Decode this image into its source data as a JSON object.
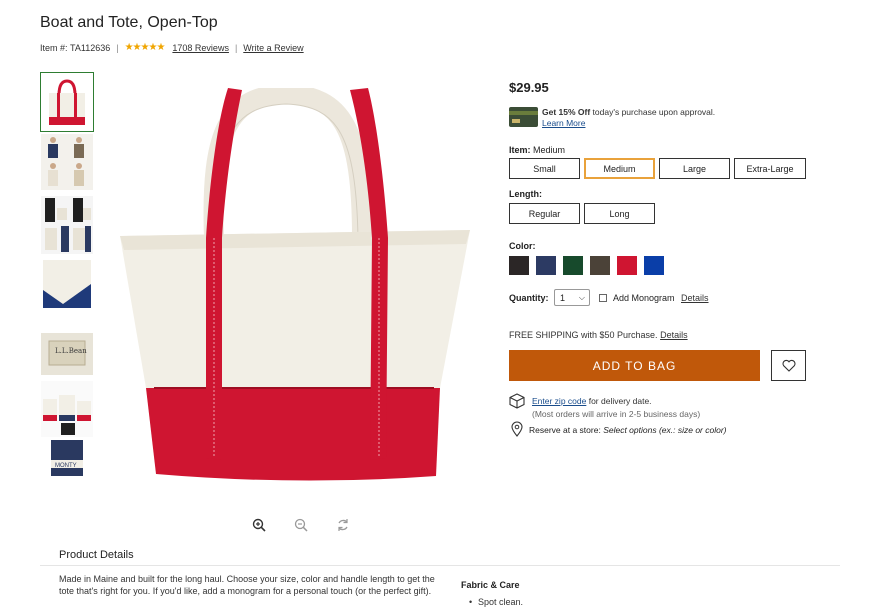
{
  "product": {
    "title": "Boat and Tote, Open-Top",
    "item_prefix": "Item #:",
    "item_number": "TA112636",
    "stars": "★★★★★",
    "reviews_link": "1708 Reviews",
    "write_review_link": "Write a Review",
    "price": "$29.95"
  },
  "credit_offer": {
    "bold": "Get 15% Off",
    "text": " today's purchase upon approval.",
    "link": "Learn More"
  },
  "item_option": {
    "label": "Item:",
    "selected_value": "Medium",
    "options": [
      "Small",
      "Medium",
      "Large",
      "Extra-Large"
    ]
  },
  "length_option": {
    "label": "Length:",
    "options": [
      "Regular",
      "Long"
    ]
  },
  "color_option": {
    "label": "Color:",
    "swatches": [
      {
        "name": "black",
        "hex": "#2b2626"
      },
      {
        "name": "navy",
        "hex": "#2c3a63"
      },
      {
        "name": "hunter-green",
        "hex": "#174a2c"
      },
      {
        "name": "brown",
        "hex": "#4b4238"
      },
      {
        "name": "red",
        "hex": "#cf1531"
      },
      {
        "name": "blue",
        "hex": "#0a3ea8"
      }
    ]
  },
  "quantity": {
    "label": "Quantity:",
    "value": "1"
  },
  "monogram": {
    "label": "Add Monogram",
    "details_link": "Details",
    "checked": false
  },
  "shipping": {
    "text": "FREE SHIPPING with $50 Purchase.",
    "details_link": "Details"
  },
  "actions": {
    "add_to_bag": "ADD TO BAG"
  },
  "delivery": {
    "zip_link": "Enter zip code",
    "zip_text": " for delivery date.",
    "note": "(Most orders will arrive in 2-5 business days)"
  },
  "reserve": {
    "label": "Reserve at a store:",
    "hint": "Select options (ex.: size or color)"
  },
  "details": {
    "heading": "Product Details",
    "description": "Made in Maine and built for the long haul. Choose your size, color and handle length to get the tote that's right for you. If you'd like, add a monogram for a personal touch (or the perfect gift).",
    "fabric_heading": "Fabric & Care",
    "fabric_items": [
      "Spot clean."
    ]
  },
  "colors": {
    "accent_orange": "#c0580a",
    "selected_border": "#e9a23b",
    "star": "#f0a500",
    "bag_red": "#cf1531",
    "canvas": "#f2efe6"
  }
}
